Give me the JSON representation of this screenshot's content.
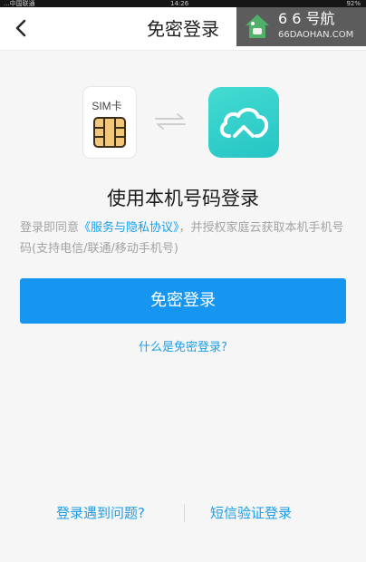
{
  "status_bar": {
    "left": "...中国联通",
    "time": "14:26",
    "right": "92%"
  },
  "header": {
    "back_icon": "chevron-left-icon",
    "title": "免密登录"
  },
  "watermark": {
    "logo_icon": "house-icon",
    "title": "6 6 号航",
    "subtitle": "66DAOHAN.COM"
  },
  "icons": {
    "sim_label": "SIM卡",
    "sim_icon": "sim-card-icon",
    "sync_icon": "sync-arrows-icon",
    "app_icon": "cloud-app-icon"
  },
  "main": {
    "heading": "使用本机号码登录",
    "desc_prefix": "登录即同意",
    "desc_link": "《服务与隐私协议》",
    "desc_suffix": "，并授权家庭云获取本机手机号码(支持电信/联通/移动手机号)",
    "primary_button": "免密登录",
    "what_link": "什么是免密登录?"
  },
  "bottom": {
    "problem_link": "登录遇到问题?",
    "sms_link": "短信验证登录"
  },
  "colors": {
    "accent": "#1696f0",
    "link": "#1aa0ea",
    "cloud_gradient_start": "#44dcd2",
    "cloud_gradient_end": "#25c4c4",
    "chip": "#e9b35f",
    "background": "#f6f6f7"
  }
}
